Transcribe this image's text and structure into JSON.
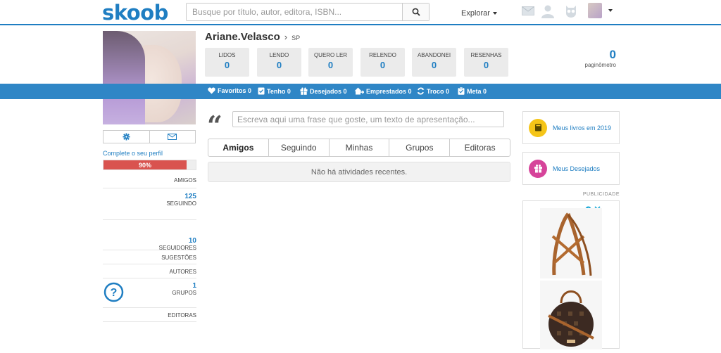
{
  "header": {
    "logo": "skoob",
    "search_placeholder": "Busque por título, autor, editora, ISBN...",
    "explore_label": "Explorar"
  },
  "profile": {
    "name": "Ariane.Velasco",
    "location": "SP",
    "complete_label": "Complete o seu perfil",
    "progress_label": "90%",
    "progress_value": 90,
    "paginometer_value": "0",
    "paginometer_label": "paginômetro"
  },
  "shelves": [
    {
      "label": "LIDOS",
      "value": "0"
    },
    {
      "label": "LENDO",
      "value": "0"
    },
    {
      "label": "QUERO LER",
      "value": "0"
    },
    {
      "label": "RELENDO",
      "value": "0"
    },
    {
      "label": "ABANDONEI",
      "value": "0"
    },
    {
      "label": "RESENHAS",
      "value": "0"
    }
  ],
  "bluebar": [
    {
      "label": "Favoritos 0",
      "icon": "heart-icon"
    },
    {
      "label": "Tenho 0",
      "icon": "book-check-icon"
    },
    {
      "label": "Desejados 0",
      "icon": "gift-icon"
    },
    {
      "label": "Emprestados 0",
      "icon": "house-arrow-icon"
    },
    {
      "label": "Troco 0",
      "icon": "exchange-icon"
    },
    {
      "label": "Meta 0",
      "icon": "clipboard-icon"
    }
  ],
  "sidebar_stats": {
    "amigos": {
      "label": "AMIGOS"
    },
    "seguindo": {
      "num": "125",
      "label": "SEGUINDO"
    },
    "seguidores": {
      "num": "10",
      "label": "SEGUIDORES"
    },
    "sugestoes": {
      "label": "SUGESTÕES"
    },
    "autores": {
      "label": "AUTORES"
    },
    "grupos": {
      "num": "1",
      "label": "GRUPOS"
    },
    "editoras": {
      "label": "EDITORAS"
    }
  },
  "main": {
    "phrase_placeholder": "Escreva aqui uma frase que goste, um texto de apresentação...",
    "tabs": [
      "Amigos",
      "Seguindo",
      "Minhas",
      "Grupos",
      "Editoras"
    ],
    "empty_message": "Não há atividades recentes."
  },
  "right": {
    "books_label": "Meus livros em 2019",
    "wishes_label": "Meus Desejados",
    "ad_label": "PUBLICIDADE"
  },
  "colors": {
    "brand": "#1f7ec2",
    "bar": "#2f86c6",
    "progress": "#d9534f",
    "books_circle": "#f5c518",
    "wishes_circle": "#d6449a"
  }
}
